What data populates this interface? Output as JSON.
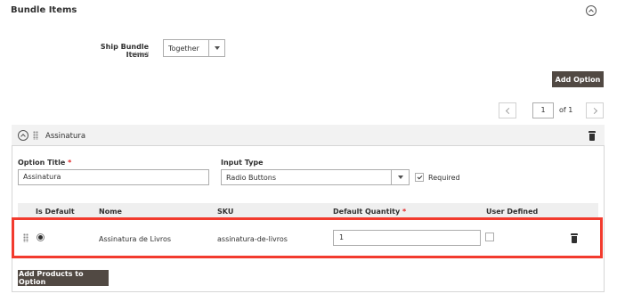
{
  "section": {
    "title": "Bundle Items"
  },
  "ship_bundle": {
    "label": "Ship Bundle Items",
    "scope": "[global]",
    "value": "Together"
  },
  "buttons": {
    "add_option": "Add Option",
    "add_products": "Add Products to Option"
  },
  "pager": {
    "current": "1",
    "of_label": "of 1"
  },
  "option": {
    "name": "Assinatura",
    "title_label": "Option Title",
    "required_mark": "*",
    "title_value": "Assinatura",
    "input_type_label": "Input Type",
    "input_type_value": "Radio Buttons",
    "required_label": "Required",
    "required_checked": true
  },
  "grid": {
    "columns": {
      "is_default": "Is Default",
      "name": "Nome",
      "sku": "SKU",
      "default_qty": "Default Quantity",
      "user_defined": "User Defined"
    },
    "rows": [
      {
        "is_default": true,
        "name": "Assinatura de Livros",
        "sku": "assinatura-de-livros",
        "qty": "1",
        "user_defined": false
      }
    ]
  },
  "colors": {
    "button_bg": "#514943",
    "highlight": "#f23b2e",
    "required": "#e22626"
  },
  "icons": [
    "chevron-up-icon",
    "dropdown-arrow-icon",
    "chevron-left-icon",
    "chevron-right-icon",
    "drag-handle-icon",
    "trash-icon",
    "checkmark-icon"
  ]
}
